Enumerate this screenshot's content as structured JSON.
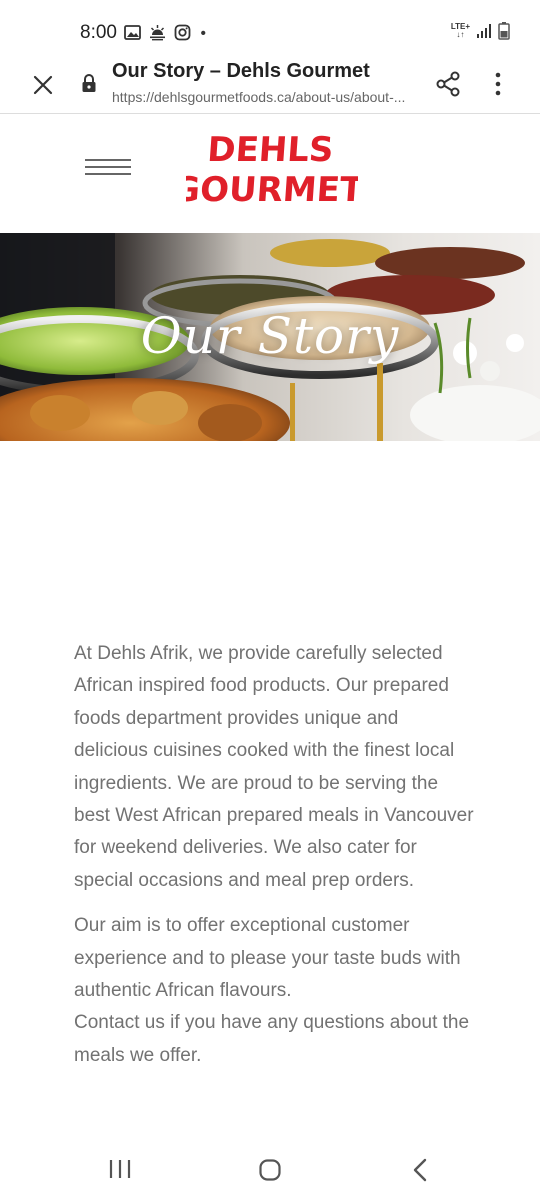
{
  "status_bar": {
    "time": "8:00",
    "network": "LTE+",
    "left_icons": [
      "gallery-icon",
      "weather-icon",
      "instagram-icon",
      "dot-icon"
    ],
    "right_icons": [
      "lte-icon",
      "signal-icon",
      "battery-icon"
    ]
  },
  "toolbar": {
    "title": "Our Story – Dehls Gourmet",
    "url": "https://dehlsgourmetfoods.ca/about-us/about-...",
    "icons": [
      "close-icon",
      "lock-icon",
      "share-icon",
      "more-vert-icon"
    ]
  },
  "site_header": {
    "logo_line1": "DEHLS",
    "logo_line2": "GOURMET",
    "logo_color": "#e0202a"
  },
  "hero": {
    "title": "Our Story"
  },
  "content": {
    "paragraph1": "At Dehls Afrik, we provide carefully selected African inspired food products. Our prepared foods department provides unique and delicious cuisines cooked with the finest local ingredients. We are proud to be serving the best West African prepared meals in Vancouver for weekend deliveries. We also cater for special occasions and meal prep orders.",
    "paragraph2": "Our aim is to offer exceptional customer experience and to please your taste buds with authentic African flavours.",
    "paragraph3": "Contact us if you have any questions about the meals we offer."
  },
  "navbar": {
    "icons": [
      "recents-icon",
      "home-icon",
      "back-icon"
    ]
  }
}
